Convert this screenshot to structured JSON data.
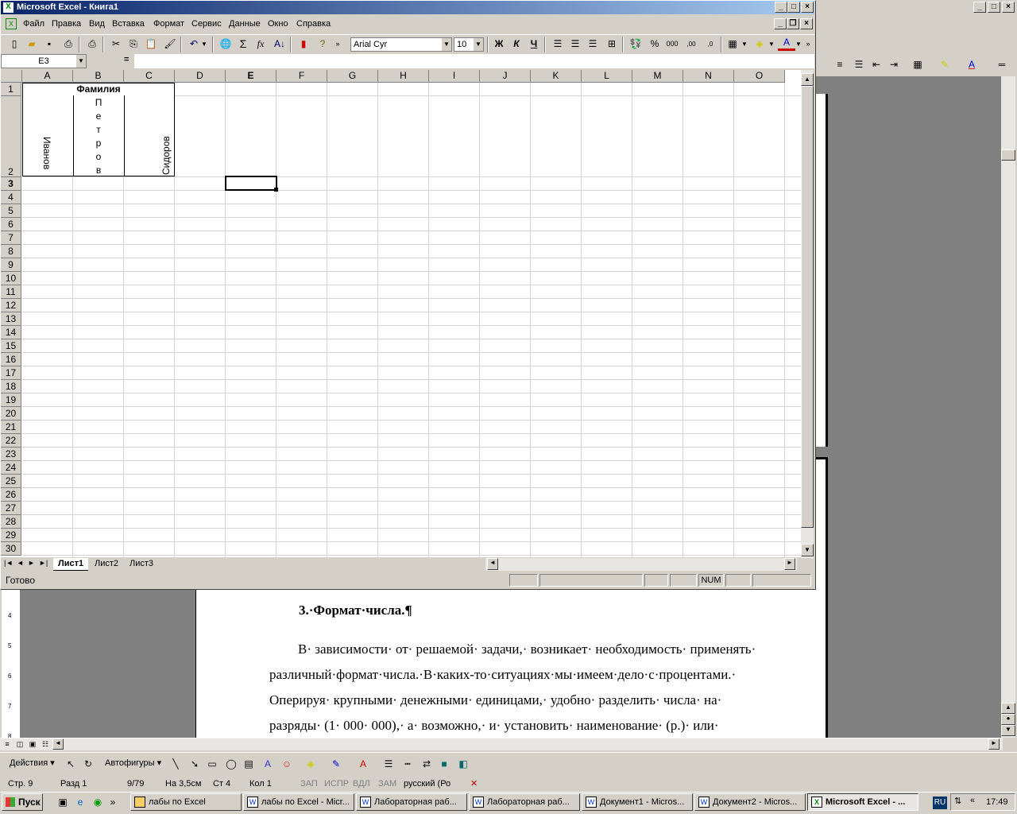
{
  "excel": {
    "title": "Microsoft Excel - Книга1",
    "menu": [
      "Файл",
      "Правка",
      "Вид",
      "Вставка",
      "Формат",
      "Сервис",
      "Данные",
      "Окно",
      "Справка"
    ],
    "font_name": "Arial Cyr",
    "font_size": "10",
    "bold": "Ж",
    "italic": "К",
    "underline": "Ч",
    "name_box": "E3",
    "formula_eq": "=",
    "columns": [
      "A",
      "B",
      "C",
      "D",
      "E",
      "F",
      "G",
      "H",
      "I",
      "J",
      "K",
      "L",
      "M",
      "N",
      "O"
    ],
    "rows": [
      "1",
      "2",
      "3",
      "4",
      "5",
      "6",
      "7",
      "8",
      "9",
      "10",
      "11",
      "12",
      "13",
      "14",
      "15",
      "16",
      "17",
      "18",
      "19",
      "20",
      "21",
      "22",
      "23",
      "24",
      "25",
      "26",
      "27",
      "28",
      "29",
      "30"
    ],
    "cells": {
      "header": "Фамилия",
      "a2": "Иванов",
      "b2": [
        "П",
        "е",
        "т",
        "р",
        "о",
        "в"
      ],
      "c2": "Сидоров"
    },
    "sheets": [
      "Лист1",
      "Лист2",
      "Лист3"
    ],
    "status": "Готово",
    "num": "NUM"
  },
  "word": {
    "heading": "3.·Формат·числа.¶",
    "para": [
      "В· зависимости· от· решаемой· задачи,· возникает· необходимость· применять·",
      "различный·формат·числа.·В·каких-то·ситуациях·мы·имеем·дело·с·процентами.·",
      "Оперируя· крупными· денежными· единицами,· удобно· разделить· числа· на·",
      "разряды· (1· 000· 000),· а· возможно,· и· установить· наименование· (р.)· или·"
    ],
    "drawing": {
      "actions": "Действия",
      "autoshapes": "Автофигуры"
    },
    "status": {
      "page": "Стр. 9",
      "section": "Разд 1",
      "pages": "9/79",
      "at": "На 3,5см",
      "line": "Ст 4",
      "col": "Кол 1",
      "rec": "ЗАП",
      "trk": "ИСПР",
      "ext": "ВДЛ",
      "ovr": "ЗАМ",
      "lang": "русский (Ро"
    }
  },
  "taskbar": {
    "start": "Пуск",
    "buttons": [
      "лабы по Excel",
      "лабы по Excel - Micr...",
      "Лабораторная раб...",
      "Лабораторная раб...",
      "Документ1 - Micros...",
      "Документ2 - Micros...",
      "Microsoft Excel - ..."
    ],
    "lang": "RU",
    "time": "17:49"
  }
}
